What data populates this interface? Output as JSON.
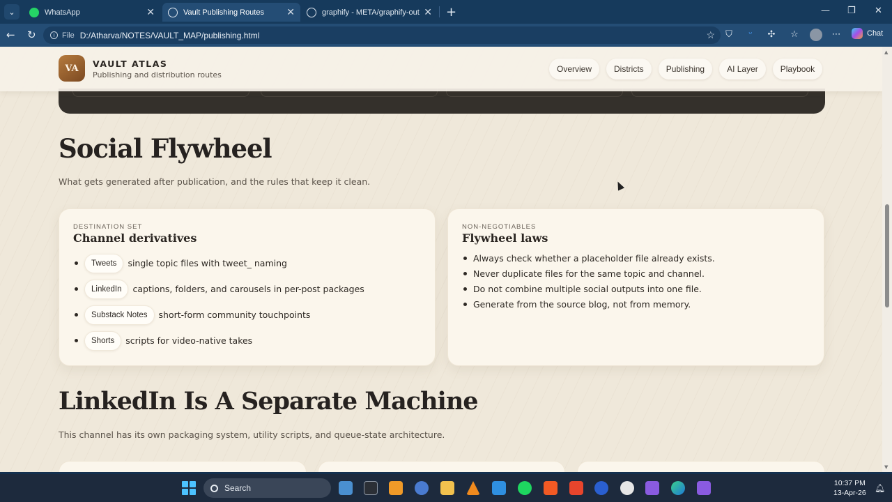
{
  "browser": {
    "tabs": [
      {
        "label": "WhatsApp",
        "icon": "whatsapp-icon",
        "color": "#25d366"
      },
      {
        "label": "Vault Publishing Routes",
        "icon": "globe-icon",
        "active": true
      },
      {
        "label": "graphify - META/graphify-out/grap",
        "icon": "globe-icon"
      }
    ],
    "address": {
      "scheme_label": "File",
      "url": "D:/Atharva/NOTES/VAULT_MAP/publishing.html"
    },
    "chat_label": "Chat"
  },
  "site": {
    "logo_initials": "VA",
    "brand_title": "VAULT ATLAS",
    "brand_subtitle": "Publishing and distribution routes",
    "nav": [
      "Overview",
      "Districts",
      "Publishing",
      "AI Layer",
      "Playbook"
    ]
  },
  "social": {
    "title": "Social Flywheel",
    "subtitle": "What gets generated after publication, and the rules that keep it clean.",
    "derivatives_card": {
      "eyebrow": "DESTINATION SET",
      "title": "Channel derivatives",
      "items": [
        {
          "chip": "Tweets",
          "text": "single topic files with tweet_ naming"
        },
        {
          "chip": "LinkedIn",
          "text": "captions, folders, and carousels in per-post packages"
        },
        {
          "chip": "Substack Notes",
          "text": "short-form community touchpoints"
        },
        {
          "chip": "Shorts",
          "text": "scripts for video-native takes"
        }
      ]
    },
    "laws_card": {
      "eyebrow": "NON-NEGOTIABLES",
      "title": "Flywheel laws",
      "items": [
        "Always check whether a placeholder file already exists.",
        "Never duplicate files for the same topic and channel.",
        "Do not combine multiple social outputs into one file.",
        "Generate from the source blog, not from memory."
      ]
    }
  },
  "linkedin": {
    "title": "LinkedIn Is A Separate Machine",
    "subtitle": "This channel has its own packaging system, utility scripts, and queue-state architecture."
  },
  "taskbar": {
    "search_placeholder": "Search",
    "time": "10:37 PM",
    "date": "13-Apr-26"
  },
  "colors": {
    "page_bg": "#efe8da",
    "card_bg": "#fbf6ec",
    "accent_brown": "#9a6230",
    "dark_band": "#34302b"
  }
}
